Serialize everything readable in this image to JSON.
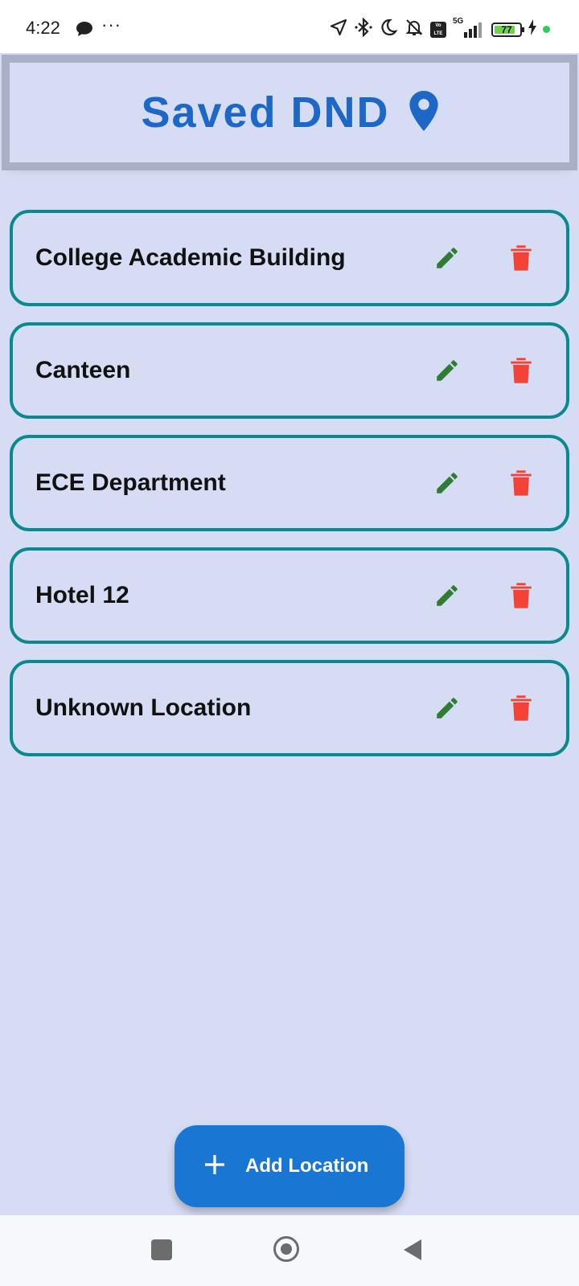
{
  "status_bar": {
    "time": "4:22",
    "battery_level": "77",
    "network": "5G",
    "volte": "Vo LTE"
  },
  "header": {
    "title": "Saved DND",
    "icon": "location-pin-icon"
  },
  "locations": [
    {
      "name": "College Academic Building"
    },
    {
      "name": "Canteen"
    },
    {
      "name": "ECE Department"
    },
    {
      "name": "Hotel 12"
    },
    {
      "name": "Unknown Location"
    }
  ],
  "fab": {
    "label": "Add Location",
    "icon": "plus-icon"
  },
  "colors": {
    "background": "#d6dcf3",
    "accent": "#1976d2",
    "card_border": "#0b8a8d",
    "edit": "#2e7d32",
    "delete": "#f44336"
  }
}
